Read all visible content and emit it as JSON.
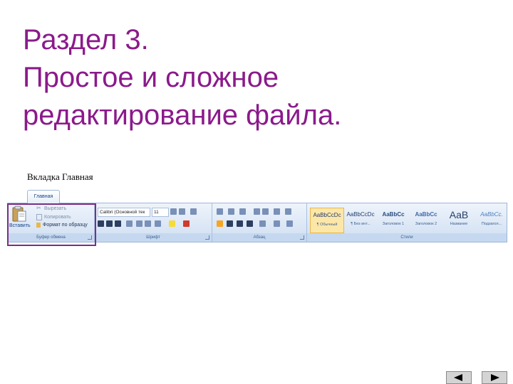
{
  "slide": {
    "title_lines": [
      "Раздел 3.",
      "Простое и сложное",
      "редактирование файла."
    ],
    "subtitle": "Вкладка Главная",
    "colors": {
      "title": "#8b1a8b",
      "highlight_frame": "#7a2f86"
    }
  },
  "ribbon": {
    "tab_label": "Главная",
    "clipboard": {
      "paste_label": "Вставить",
      "items": [
        "Вырезать",
        "Копировать",
        "Формат по образцу"
      ],
      "group_label": "Буфер обмена"
    },
    "font": {
      "font_name": "Calibri (Основной тек",
      "font_size": "11",
      "group_label": "Шрифт"
    },
    "paragraph": {
      "group_label": "Абзац"
    },
    "styles": {
      "items": [
        {
          "sample": "AaBbCcDc",
          "name": "¶ Обычный"
        },
        {
          "sample": "AaBbCcDc",
          "name": "¶ Без инт..."
        },
        {
          "sample": "AaBbCc",
          "name": "Заголовок 1"
        },
        {
          "sample": "AaBbCc",
          "name": "Заголовок 2"
        },
        {
          "sample": "AaB",
          "name": "Название"
        },
        {
          "sample": "AaBbCc.",
          "name": "Подзагол..."
        }
      ],
      "group_label": "Стили"
    }
  },
  "navigation": {
    "prev_icon": "left-triangle-icon",
    "next_icon": "right-triangle-icon"
  }
}
